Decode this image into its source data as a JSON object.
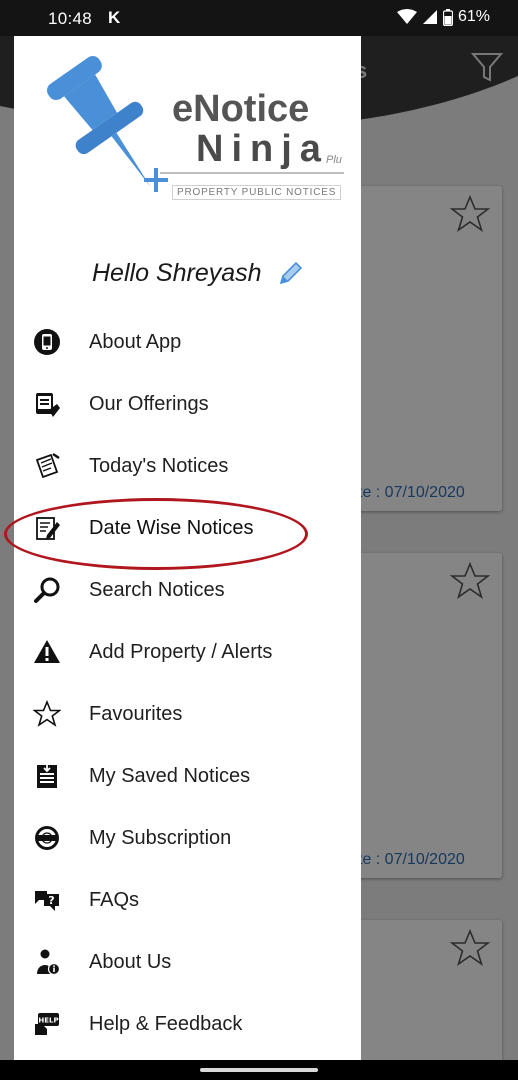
{
  "status_bar": {
    "time": "10:48",
    "app_indicator": "K",
    "battery": "61%"
  },
  "background_app": {
    "header_title_fragment": "s",
    "cards": [
      {
        "date_fragment": "te : 07/10/2020"
      },
      {
        "date_fragment": "te : 07/10/2020"
      },
      {
        "date_fragment": ""
      }
    ]
  },
  "drawer": {
    "logo": {
      "line1": "eNotice",
      "line2": "Ninja",
      "suffix": "Plu",
      "tagline": "PROPERTY PUBLIC NOTICES"
    },
    "greeting": "Hello Shreyash",
    "highlighted_item": "Date Wise Notices",
    "menu": [
      {
        "label": "About App",
        "icon": "phone-circle-icon"
      },
      {
        "label": "Our Offerings",
        "icon": "tablet-hand-icon"
      },
      {
        "label": "Today's Notices",
        "icon": "notepad-pen-icon"
      },
      {
        "label": "Date Wise Notices",
        "icon": "edit-document-icon"
      },
      {
        "label": "Search Notices",
        "icon": "magnifier-icon"
      },
      {
        "label": "Add Property / Alerts",
        "icon": "warning-triangle-icon"
      },
      {
        "label": "Favourites",
        "icon": "star-outline-icon"
      },
      {
        "label": "My Saved Notices",
        "icon": "saved-notice-icon"
      },
      {
        "label": "My Subscription",
        "icon": "subscription-seal-icon"
      },
      {
        "label": "FAQs",
        "icon": "faq-bubbles-icon"
      },
      {
        "label": "About Us",
        "icon": "person-info-icon"
      },
      {
        "label": "Help & Feedback",
        "icon": "help-chat-icon"
      }
    ]
  },
  "colors": {
    "accent_blue": "#4a90d9",
    "highlight_red": "#b0161d",
    "date_blue": "#2f6db3"
  }
}
